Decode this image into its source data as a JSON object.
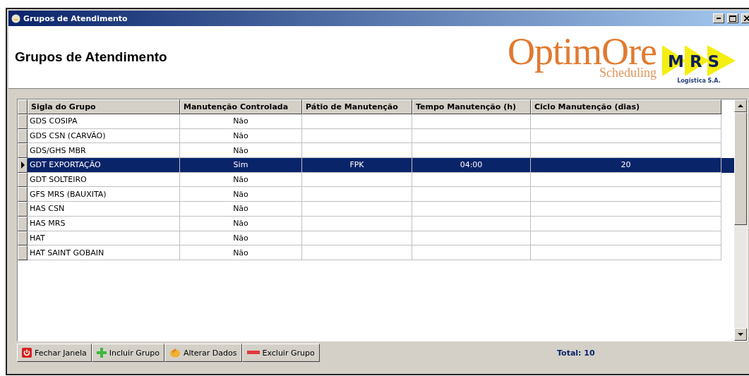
{
  "window": {
    "title": "Grupos de Atendimento"
  },
  "header": {
    "title": "Grupos de Atendimento",
    "logo": {
      "name": "OptimOre",
      "subtitle": "Scheduling"
    },
    "partner_logo": {
      "name": "MRS",
      "subtitle": "Logística S.A."
    }
  },
  "table": {
    "columns": [
      "Sigla do Grupo",
      "Manutenção Controlada",
      "Pátio de Manutenção",
      "Tempo Manutenção (h)",
      "Ciclo Manutenção (dias)"
    ],
    "rows": [
      {
        "cells": [
          "GDS COSIPA",
          "Não",
          "",
          "",
          ""
        ],
        "selected": false
      },
      {
        "cells": [
          "GDS CSN (CARVÃO)",
          "Não",
          "",
          "",
          ""
        ],
        "selected": false
      },
      {
        "cells": [
          "GDS/GHS MBR",
          "Não",
          "",
          "",
          ""
        ],
        "selected": false
      },
      {
        "cells": [
          "GDT EXPORTAÇÃO",
          "Sim",
          "FPK",
          "04:00",
          "20"
        ],
        "selected": true
      },
      {
        "cells": [
          "GDT SOLTEIRO",
          "Não",
          "",
          "",
          ""
        ],
        "selected": false
      },
      {
        "cells": [
          "GFS MRS (BAUXITA)",
          "Não",
          "",
          "",
          ""
        ],
        "selected": false
      },
      {
        "cells": [
          "HAS CSN",
          "Não",
          "",
          "",
          ""
        ],
        "selected": false
      },
      {
        "cells": [
          "HAS MRS",
          "Não",
          "",
          "",
          ""
        ],
        "selected": false
      },
      {
        "cells": [
          "HAT",
          "Não",
          "",
          "",
          ""
        ],
        "selected": false
      },
      {
        "cells": [
          "HAT SAINT GOBAIN",
          "Não",
          "",
          "",
          ""
        ],
        "selected": false
      }
    ]
  },
  "toolbar": {
    "buttons": [
      {
        "kind": "close",
        "label": "Fechar Janela"
      },
      {
        "kind": "add",
        "label": "Incluir Grupo"
      },
      {
        "kind": "edit",
        "label": "Alterar Dados"
      },
      {
        "kind": "delete",
        "label": "Excluir Grupo"
      }
    ],
    "total": "Total: 10"
  }
}
